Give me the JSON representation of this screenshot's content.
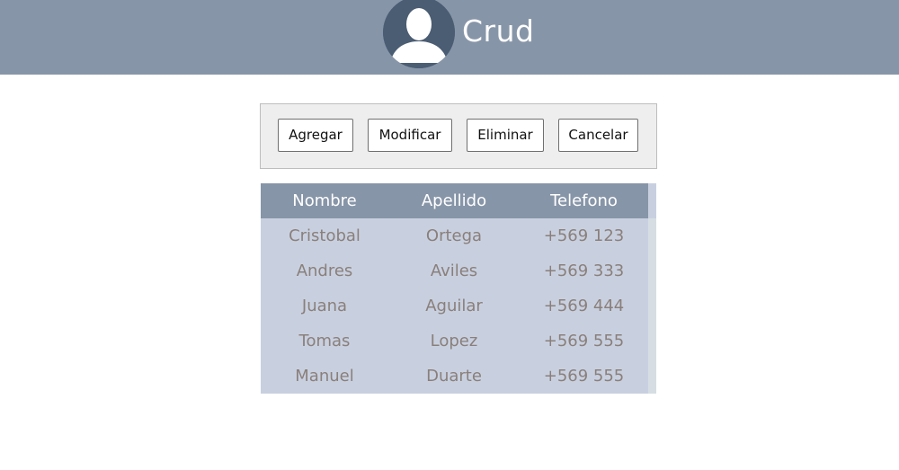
{
  "header": {
    "title": "Crud",
    "avatar_icon": "user-avatar-icon",
    "background": "#8795a8"
  },
  "toolbar": {
    "buttons": [
      {
        "label": "Agregar"
      },
      {
        "label": "Modificar"
      },
      {
        "label": "Eliminar"
      },
      {
        "label": "Cancelar"
      }
    ]
  },
  "table": {
    "columns": [
      "Nombre",
      "Apellido",
      "Telefono"
    ],
    "rows": [
      [
        "Cristobal",
        "Ortega",
        "+569 123"
      ],
      [
        "Andres",
        "Aviles",
        "+569 333"
      ],
      [
        "Juana",
        "Aguilar",
        "+569 444"
      ],
      [
        "Tomas",
        "Lopez",
        "+569 555"
      ],
      [
        "Manuel",
        "Duarte",
        "+569 555"
      ]
    ],
    "header_color": "#8795a8",
    "body_color": "#c8d0e0"
  }
}
